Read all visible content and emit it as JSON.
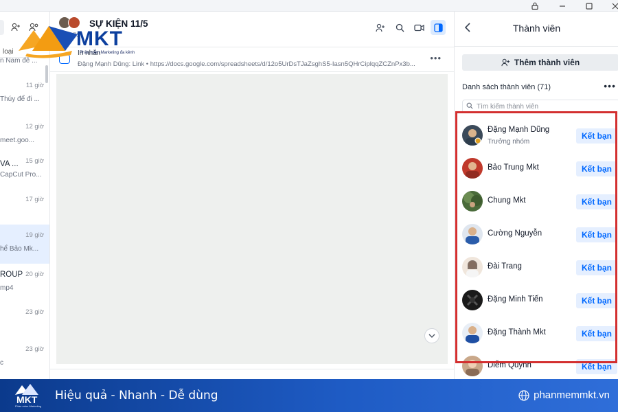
{
  "window_controls": [
    "lock-icon",
    "minimize-icon",
    "maximize-icon",
    "close-icon"
  ],
  "left_panel": {
    "filter_label": "loại",
    "conversations": [
      {
        "time": "",
        "name": "",
        "preview": "n Nam đê ..."
      },
      {
        "time": "11 giờ",
        "name": "",
        "preview": "Thúy để đi ..."
      },
      {
        "time": "12 giờ",
        "name": "",
        "preview": "meet.goo..."
      },
      {
        "time": "15 giờ",
        "name": "VA ...",
        "preview": "CapCut Pro..."
      },
      {
        "time": "17 giờ",
        "name": "",
        "preview": ""
      },
      {
        "time": "19 giờ",
        "name": "",
        "preview": "hể Bảo Mk..."
      },
      {
        "time": "20 giờ",
        "name": "ROUP",
        "preview": "mp4"
      },
      {
        "time": "23 giờ",
        "name": "",
        "preview": ""
      },
      {
        "time": "23 giờ",
        "name": "",
        "preview": "c"
      }
    ]
  },
  "chat": {
    "title": "SỰ KIỆN 11/5",
    "member_count": "71",
    "pinned_label": "In nhắn",
    "pinned_text": "Đặng Mạnh Dũng:    Link • https://docs.google.com/spreadsheets/d/12o5UrDsTJaZsghS5-Iasn5QHrCiplqqZCZnPx3b...",
    "header_icons": [
      "add-member-icon",
      "search-icon",
      "video-call-icon",
      "sidebar-toggle-icon"
    ]
  },
  "right_panel": {
    "title": "Thành viên",
    "add_member_label": "Thêm thành viên",
    "list_title": "Danh sách thành viên (71)",
    "search_placeholder": "Tìm kiếm thành viên",
    "friend_label": "Kết bạn",
    "members": [
      {
        "name": "Đặng Mạnh Dũng",
        "role": "Trưởng nhóm",
        "color": "#3b4a5a"
      },
      {
        "name": "Bảo Trung Mkt",
        "role": "",
        "color": "#c0392b"
      },
      {
        "name": "Chung Mkt",
        "role": "",
        "color": "#4a6b3a"
      },
      {
        "name": "Cường Nguyễn",
        "role": "",
        "color": "#2a5caa"
      },
      {
        "name": "Đài Trang",
        "role": "",
        "color": "#e8d8c8"
      },
      {
        "name": "Đặng Minh Tiến",
        "role": "",
        "color": "#1a1a1a"
      },
      {
        "name": "Đặng Thành Mkt",
        "role": "",
        "color": "#1f4fa3"
      },
      {
        "name": "Diễm Quỳnh",
        "role": "",
        "color": "#c9a88a"
      }
    ]
  },
  "overlay_logo": {
    "brand": "MKT",
    "tagline": "Phần mềm Marketing đa kênh"
  },
  "banner": {
    "logo_text": "MKT",
    "logo_sub": "Phần mềm Marketing",
    "slogan": "Hiệu quả - Nhanh  - Dễ dùng",
    "website": "phanmemmkt.vn"
  },
  "colors": {
    "accent": "#0068ff",
    "highlight": "#d32f2f",
    "banner": "#1e5bc4"
  }
}
